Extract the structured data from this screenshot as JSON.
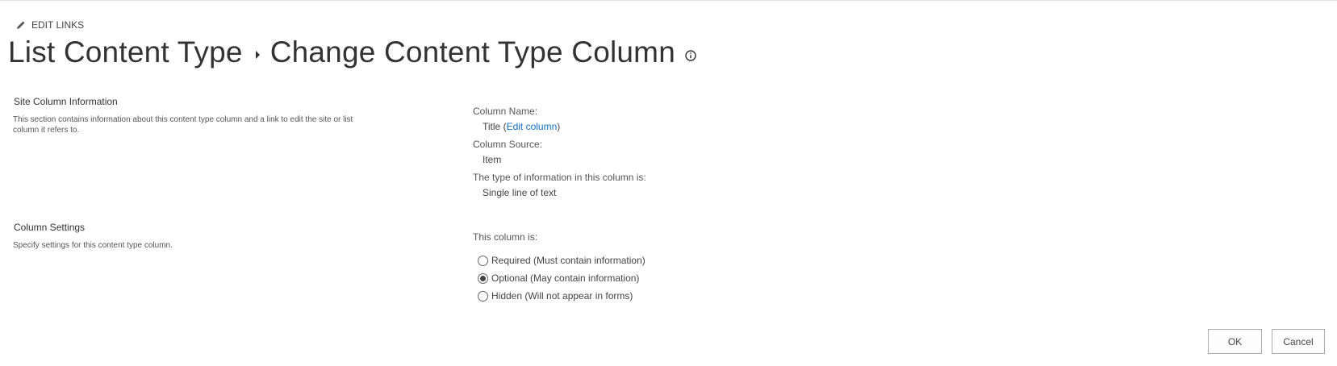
{
  "header": {
    "edit_links_label": "EDIT LINKS",
    "edit_links_icon": "pencil-icon",
    "breadcrumb_parent": "List Content Type",
    "breadcrumb_separator_icon": "caret-right-icon",
    "page_title": "Change Content Type Column",
    "info_icon": "info-icon"
  },
  "site_column_section": {
    "title": "Site Column Information",
    "description": "This section contains information about this content type column and a link to edit the site or list column it refers to.",
    "column_name_label": "Column Name:",
    "column_name_value": "Title",
    "edit_column_link": "Edit column",
    "column_source_label": "Column Source:",
    "column_source_value": "Item",
    "type_label": "The type of information in this column is:",
    "type_value": "Single line of text"
  },
  "column_settings_section": {
    "title": "Column Settings",
    "description": "Specify settings for this content type column.",
    "prompt": "This column is:",
    "options": [
      {
        "label": "Required (Must contain information)",
        "selected": false
      },
      {
        "label": "Optional (May contain information)",
        "selected": true
      },
      {
        "label": "Hidden (Will not appear in forms)",
        "selected": false
      }
    ]
  },
  "actions": {
    "ok_label": "OK",
    "cancel_label": "Cancel"
  },
  "colors": {
    "link": "#106ebe",
    "text": "#333333"
  }
}
